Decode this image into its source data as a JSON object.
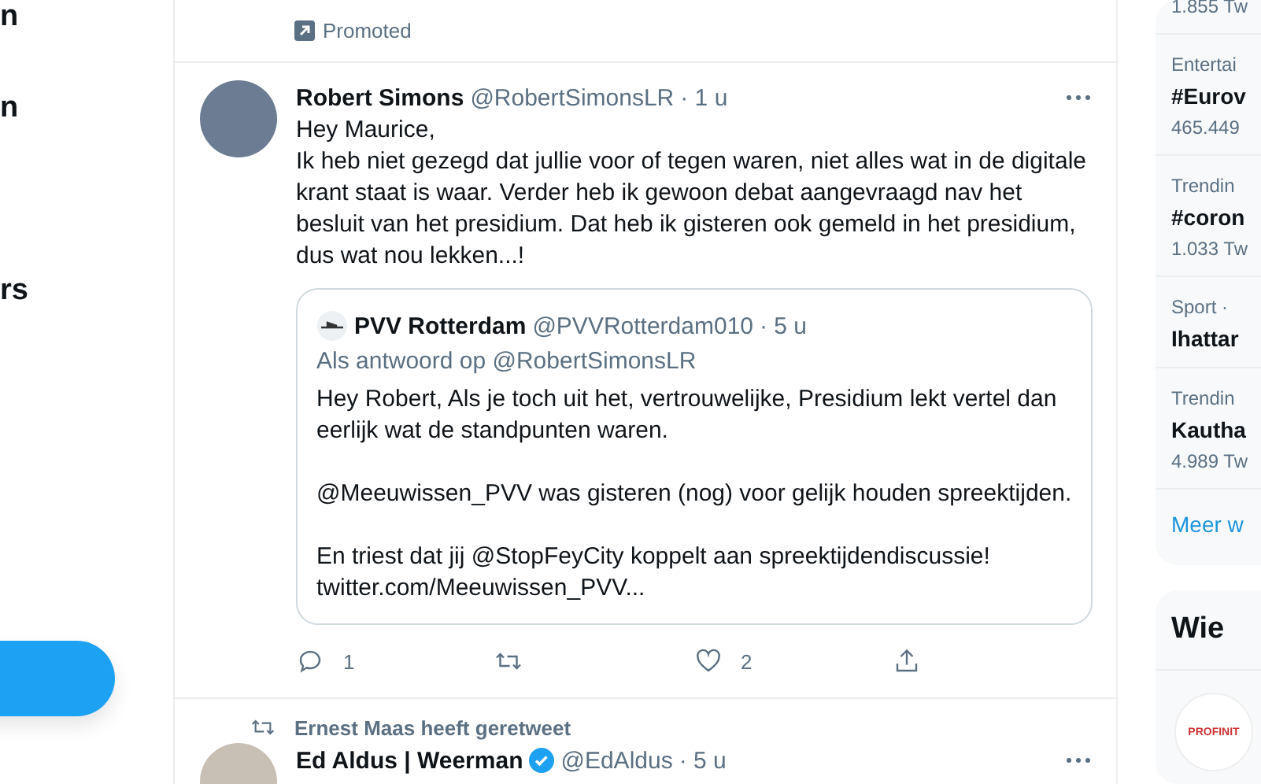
{
  "nav": {
    "items": [
      {
        "label": "n"
      },
      {
        "label": "n"
      },
      {
        "label": "rs"
      }
    ]
  },
  "promoted": {
    "label": "Promoted"
  },
  "tweet": {
    "name": "Robert Simons",
    "handle": "@RobertSimonsLR",
    "time": "· 1 u",
    "lines": [
      "Hey Maurice,",
      "Ik heb niet gezegd dat jullie voor of tegen waren, niet alles wat in de digitale krant staat is waar. Verder heb ik gewoon debat aangevraagd nav het besluit van het presidium. Dat heb ik gisteren ook gemeld in het presidium, dus wat nou lekken...!"
    ],
    "quote": {
      "name": "PVV Rotterdam",
      "handle": "@PVVRotterdam010",
      "time": "· 5 u",
      "reply_to": "Als antwoord op @RobertSimonsLR",
      "paragraphs": [
        "Hey Robert, Als je toch uit het, vertrouwelijke, Presidium lekt vertel dan eerlijk wat de standpunten waren.",
        "@Meeuwissen_PVV was gisteren (nog) voor gelijk houden spreektijden.",
        "En triest dat jij @StopFeyCity koppelt aan spreektijdendiscussie!\ntwitter.com/Meeuwissen_PVV..."
      ]
    },
    "actions": [
      {
        "kind": "reply",
        "count": "1"
      },
      {
        "kind": "retweet"
      },
      {
        "kind": "like",
        "count": "2",
        "liked": false
      },
      {
        "kind": "share"
      }
    ]
  },
  "next_tweet": {
    "retweeted_by": "Ernest Maas heeft geretweet",
    "name": "Ed Aldus | Weerman",
    "verified": true,
    "handle": "@EdAldus",
    "time": "· 5 u"
  },
  "trends": [
    {
      "kind": "count",
      "lines": [
        "1.855 Tw"
      ]
    },
    {
      "kind": "trend",
      "category": "Entertai",
      "title": "#Eurov",
      "count": "465.449"
    },
    {
      "kind": "trend",
      "category": "Trendin",
      "title": "#coron",
      "count": "1.033 Tw"
    },
    {
      "kind": "trend",
      "category": "Sport · ",
      "title": "Ihattar"
    },
    {
      "kind": "trend",
      "category": "Trendin",
      "title": "Kautha",
      "count": "4.989 Tw"
    }
  ],
  "more_link": "Meer w",
  "who_to_follow": {
    "title": "Wie",
    "avatar_text": "PROFINIT"
  }
}
